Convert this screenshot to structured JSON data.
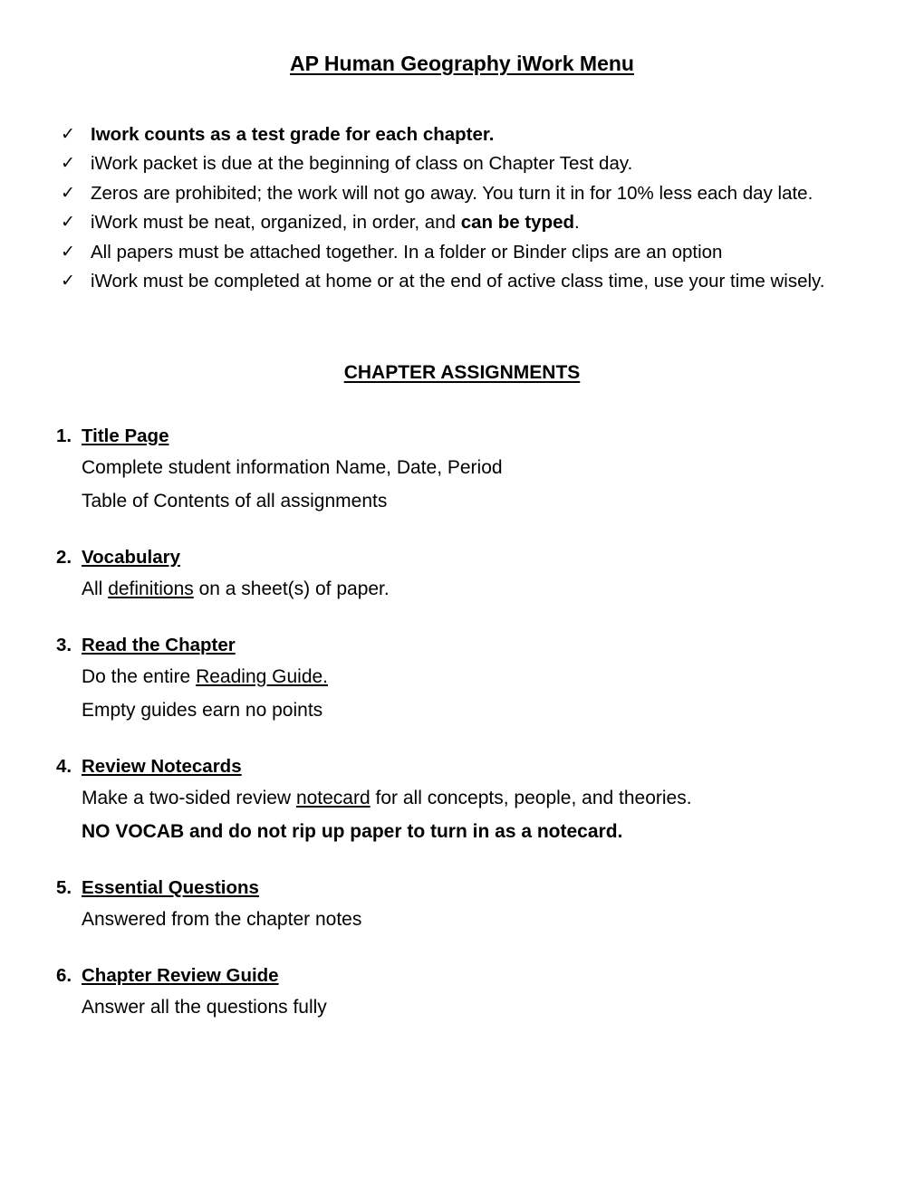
{
  "document": {
    "title": "AP Human Geography iWork Menu",
    "section_heading": "CHAPTER ASSIGNMENTS"
  },
  "rules": {
    "bullet_icon": "checkmark-icon",
    "bullet_glyph": "✓",
    "items": [
      {
        "text": "Iwork counts as a test grade for each chapter.",
        "bold": true
      },
      {
        "text": "iWork packet is due at the beginning of class on Chapter Test day.",
        "bold": false
      },
      {
        "text": "Zeros are prohibited; the work will not go away. You turn it in for 10% less each day late.",
        "bold": false
      },
      {
        "text_before": "iWork must be neat, organized, in order, and ",
        "bold_part": "can be typed",
        "text_after": ".",
        "bold": false
      },
      {
        "text": "All papers must be attached together. In a folder or Binder clips are an option",
        "bold": false
      },
      {
        "text": "iWork must be completed at home or at the end of active class time, use your time wisely.",
        "bold": false
      }
    ]
  },
  "assignments": [
    {
      "number": "1.",
      "title": "Title Page",
      "lines": [
        {
          "text": "Complete student information Name, Date, Period",
          "bold": false
        },
        {
          "text": "Table of Contents of all assignments",
          "bold": false
        }
      ]
    },
    {
      "number": "2.",
      "title": "Vocabulary ",
      "lines": [
        {
          "prefix": "All ",
          "underlined": "definitions",
          "suffix": " on a sheet(s) of paper.",
          "bold": false
        }
      ]
    },
    {
      "number": "3.",
      "title": "Read the Chapter",
      "lines": [
        {
          "prefix": "Do the entire ",
          "underlined": "Reading Guide. ",
          "suffix": "",
          "bold": false
        },
        {
          "text": "Empty guides earn no points",
          "bold": false
        }
      ]
    },
    {
      "number": "4.",
      "title": "Review Notecards",
      "lines": [
        {
          "prefix": "Make a two-sided review ",
          "underlined": "notecard",
          "suffix": " for all concepts, people, and theories.",
          "bold": false
        },
        {
          "text": "NO VOCAB and do not rip up paper to turn in as a notecard.",
          "bold": true
        }
      ]
    },
    {
      "number": "5.",
      "title": "Essential Questions",
      "lines": [
        {
          "text": "Answered from the chapter notes",
          "bold": false
        }
      ]
    },
    {
      "number": "6.",
      "title": "Chapter Review Guide",
      "lines": [
        {
          "text": "Answer all the questions fully",
          "bold": false
        }
      ]
    }
  ]
}
